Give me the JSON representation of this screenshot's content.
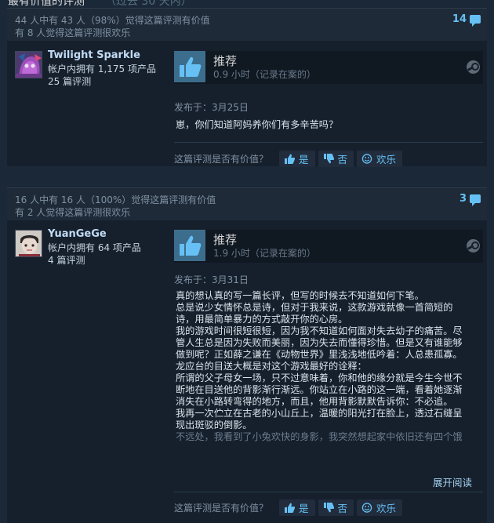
{
  "section": {
    "title": "最有价值的评测",
    "subtitle": "（过去 30 天内）"
  },
  "reviews": [
    {
      "helpful_line": "44 人中有 43 人（98%）觉得这篇评测有价值",
      "funny_line": "有 8 人觉得这篇评测很欢乐",
      "comment_count": "14",
      "author": {
        "name": "Twilight Sparkle",
        "games": "帐户内拥有 1,175 项产品",
        "reviews": "25 篇评测"
      },
      "verdict": "推荐",
      "hours": "0.9 小时（记录在案的）",
      "posted": "发布于：3月25日",
      "text": [
        "崽，你们知道阿妈养你们有多辛苦吗？"
      ]
    },
    {
      "helpful_line": "16 人中有 16 人（100%）觉得这篇评测有价值",
      "funny_line": "有 2 人觉得这篇评测很欢乐",
      "comment_count": "3",
      "author": {
        "name": "YuanGeGe",
        "games": "帐户内拥有 64 项产品",
        "reviews": "4 篇评测"
      },
      "verdict": "推荐",
      "hours": "1.9 小时（记录在案的）",
      "posted": "发布于：3月31日",
      "text": [
        "真的想认真的写一篇长评，但写的时候去不知道如何下笔。",
        "总是说少女情怀总是诗，但对于我来说，这款游戏就像一首简短的",
        "诗，用最简单暴力的方式敲开你的心房。",
        "我的游戏时间很短很短，因为我不知道如何面对失去幼子的痛苦。尽",
        "管人生总是因为失败而美丽，因为失去而懂得珍惜。但是又有谁能够",
        "做到呢？正如薛之谦在《动物世界》里浅浅地低吟着：人总患孤寡。",
        "龙应台的目送大概是对这个游戏最好的诠释：",
        "所谓的父子母女一场，只不过意味着，你和他的缘分就是今生今世不",
        "断地在目送他的背影渐行渐远。你站立在小路的这一端，看着她逐渐",
        "消失在小路转弯得的地方，而且，他用背影默默告诉你：不必追。",
        "我再一次伫立在古老的小山丘上，温暖的阳光打在脸上，透过石缝呈",
        "现出斑驳的倒影。",
        "不远处，我看到了小兔欢快的身影，我突然想起家中依旧还有四个饿"
      ],
      "expand_label": "展开阅读"
    }
  ],
  "helpful_prompt": "这篇评测是否有价值？",
  "buttons": {
    "yes": "是",
    "no": "否",
    "funny": "欢乐"
  }
}
